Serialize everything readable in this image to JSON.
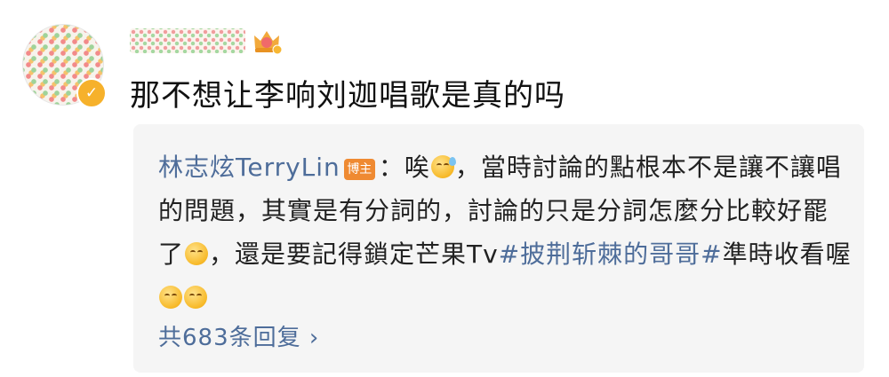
{
  "post": {
    "text": "那不想让李响刘迦唱歌是真的吗"
  },
  "quote": {
    "author": "林志炫TerryLin",
    "author_badge": "博主",
    "colon": "：",
    "seg1": "唉",
    "seg2": "，當時討論的點根本不是讓不讓唱的問題，其實是有分詞的，討論的只是分詞怎麼分比較好罷了",
    "seg3": "，還是要記得鎖定芒果Tv",
    "topic": "#披荆斩棘的哥哥#",
    "seg4": "準時收看喔",
    "replies_label": "共683条回复",
    "replies_arrow": "›"
  },
  "colors": {
    "link": "#4e6d9a",
    "card_bg": "#f5f5f5",
    "verified": "#f6b12b",
    "badge": "#ef8a32"
  },
  "icons": [
    "verified-badge-icon",
    "level-crown-icon",
    "sweat-emoji-icon",
    "smile-emoji-icon",
    "blush-emoji-icon",
    "chevron-right-icon"
  ]
}
